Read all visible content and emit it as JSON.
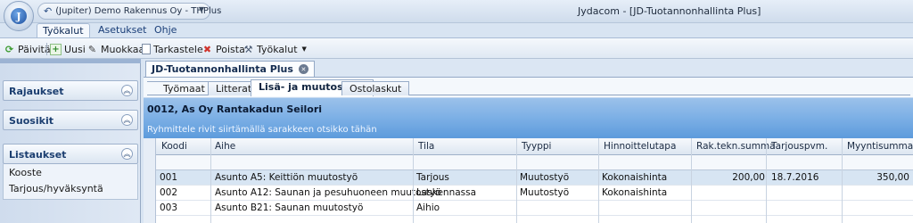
{
  "titlebar": {
    "quick_access_text": "(Jupiter) Demo Rakennus Oy - THPlus",
    "window_title": "Jydacom - [JD-Tuotannonhallinta Plus]",
    "logo_letter": "J"
  },
  "ribbon": {
    "tabs": [
      {
        "label": "Työkalut"
      },
      {
        "label": "Asetukset"
      },
      {
        "label": "Ohje"
      }
    ]
  },
  "toolbar": {
    "paivita": "Päivitä",
    "uusi": "Uusi",
    "muokkaa": "Muokkaa",
    "tarkastele": "Tarkastele",
    "poista": "Poista",
    "tyokalut": "Työkalut"
  },
  "sidebar": {
    "groups": [
      {
        "title": "Rajaukset"
      },
      {
        "title": "Suosikit"
      },
      {
        "title": "Listaukset"
      }
    ],
    "items": [
      {
        "label": "Kooste"
      },
      {
        "label": "Tarjous/hyväksyntä"
      }
    ]
  },
  "document": {
    "tab_title": "JD-Tuotannonhallinta Plus",
    "subtabs": [
      {
        "label": "Työmaat"
      },
      {
        "label": "Litterat"
      },
      {
        "label": "Lisä- ja muutostyöt"
      },
      {
        "label": "Ostolaskut"
      }
    ],
    "project": "0012, As Oy Rantakadun Seilori",
    "group_hint": "Ryhmittele rivit siirtämällä sarakkeen otsikko tähän"
  },
  "grid": {
    "columns": {
      "koodi": "Koodi",
      "aihe": "Aihe",
      "tila": "Tila",
      "tyyppi": "Tyyppi",
      "hinnoittelutapa": "Hinnoittelutapa",
      "rak_tekn_summa": "Rak.tekn.summa",
      "tarjouspvm": "Tarjouspvm.",
      "myyntisumma": "Myyntisumma"
    },
    "rows": [
      {
        "koodi": "001",
        "aihe": "Asunto A5: Keittiön muutostyö",
        "tila": "Tarjous",
        "tyyppi": "Muutostyö",
        "hinnoittelutapa": "Kokonaishinta",
        "rak_tekn_summa": "200,00",
        "tarjouspvm": "18.7.2016",
        "myyntisumma": "350,00"
      },
      {
        "koodi": "002",
        "aihe": "Asunto A12: Saunan ja pesuhuoneen muutostyö",
        "tila": "Laskennassa",
        "tyyppi": "Muutostyö",
        "hinnoittelutapa": "Kokonaishinta",
        "rak_tekn_summa": "",
        "tarjouspvm": "",
        "myyntisumma": ""
      },
      {
        "koodi": "003",
        "aihe": "Asunto B21: Saunan muutostyö",
        "tila": "Aihio",
        "tyyppi": "",
        "hinnoittelutapa": "",
        "rak_tekn_summa": "",
        "tarjouspvm": "",
        "myyntisumma": ""
      }
    ]
  },
  "colors": {
    "header_band": "#7fb1e6",
    "selected_row": "#d7e5f3",
    "delete_icon": "#d0342c",
    "refresh_icon": "#3a9a2e"
  }
}
